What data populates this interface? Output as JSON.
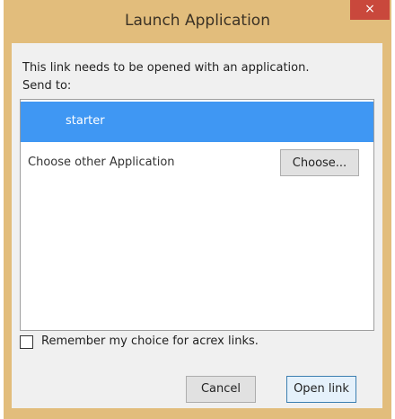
{
  "window": {
    "title": "Launch Application",
    "close_glyph": "×",
    "frame_color": "#e2bd7c",
    "close_color": "#c9483c"
  },
  "message": {
    "line1": "This link needs to be opened with an application.",
    "line2": "Send to:"
  },
  "app_list": {
    "items": [
      {
        "label": "starter",
        "selected": true
      },
      {
        "label": "Choose other Application",
        "selected": false
      }
    ],
    "selected_color": "#3f97f3"
  },
  "choose_button": {
    "label": "Choose..."
  },
  "remember": {
    "label": "Remember my choice for acrex links.",
    "checked": false
  },
  "buttons": {
    "cancel": "Cancel",
    "open": "Open link"
  }
}
